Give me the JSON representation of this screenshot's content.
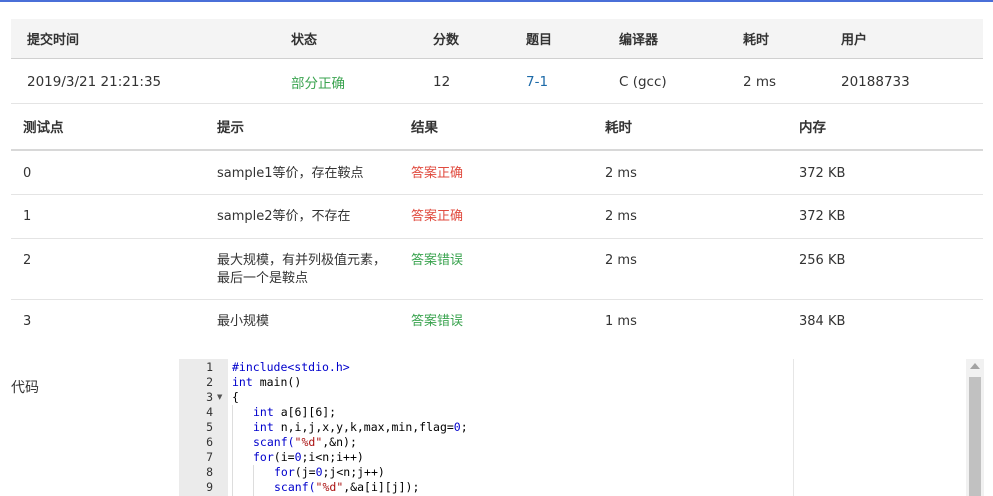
{
  "submission": {
    "headers": [
      "提交时间",
      "状态",
      "分数",
      "题目",
      "编译器",
      "耗时",
      "用户"
    ],
    "time": "2019/3/21 21:21:35",
    "status": "部分正确",
    "score": "12",
    "problem": "7-1",
    "compiler": "C (gcc)",
    "duration": "2 ms",
    "user": "20188733"
  },
  "testpoints": {
    "headers": [
      "测试点",
      "提示",
      "结果",
      "耗时",
      "内存"
    ],
    "rows": [
      {
        "id": "0",
        "hint": "sample1等价，存在鞍点",
        "result": "答案正确",
        "time": "2 ms",
        "memory": "372 KB"
      },
      {
        "id": "1",
        "hint": "sample2等价，不存在",
        "result": "答案正确",
        "time": "2 ms",
        "memory": "372 KB"
      },
      {
        "id": "2",
        "hint_line1": "最大规模，有并列极值元素，",
        "hint_line2": "最后一个是鞍点",
        "result": "答案错误",
        "time": "2 ms",
        "memory": "256 KB"
      },
      {
        "id": "3",
        "hint": "最小规模",
        "result": "答案错误",
        "time": "1 ms",
        "memory": "384 KB"
      }
    ]
  },
  "code_section": {
    "label": "代码",
    "line_numbers": [
      "1",
      "2",
      "3",
      "4",
      "5",
      "6",
      "7",
      "8",
      "9"
    ],
    "lines": {
      "l1": "#include<stdio.h>",
      "l2a": "int",
      "l2b": " main()",
      "l3": "{",
      "l4a": "int",
      "l4b": " a[6][6];",
      "l5a": "int",
      "l5b": " n,i,j,x,y,k,max,min,flag=",
      "l5c": "0",
      "l5d": ";",
      "l6a": "scanf(",
      "l6b": "\"%d\"",
      "l6c": ",&n);",
      "l7a": "for",
      "l7b": "(i=",
      "l7c": "0",
      "l7d": ";i<n;i++)",
      "l8a": "for",
      "l8b": "(j=",
      "l8c": "0",
      "l8d": ";j<n;j++)",
      "l9a": "scanf(",
      "l9b": "\"%d\"",
      "l9c": ",&a[i][j]);"
    }
  },
  "colors": {
    "accent_line": "#4a6fd8",
    "partial_correct": "#3aa34f",
    "correct_answer": "#e04b3f",
    "wrong_answer": "#3aa34f",
    "problem_link": "#1d6aa8"
  }
}
